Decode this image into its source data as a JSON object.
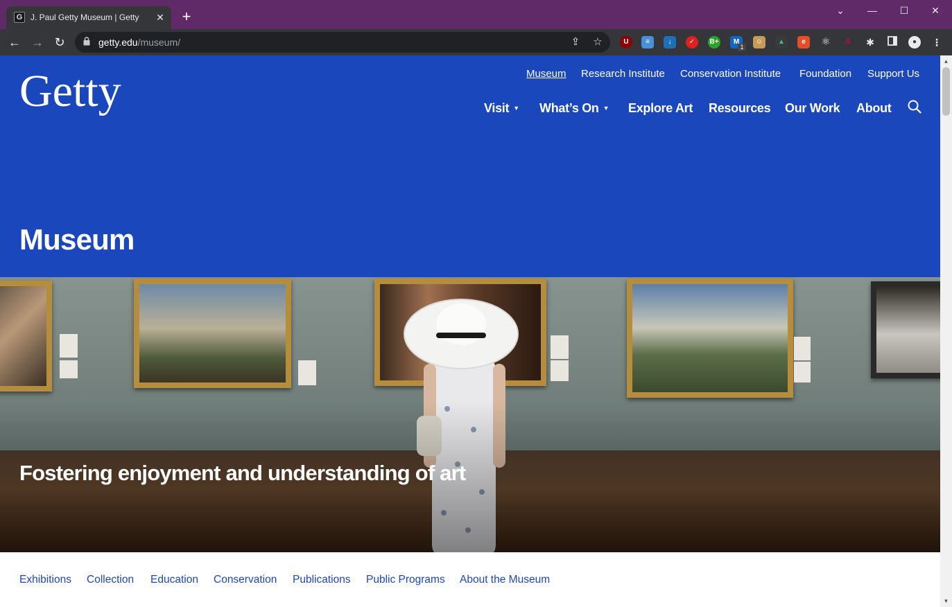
{
  "browser": {
    "tab_title": "J. Paul Getty Museum | Getty",
    "url_host": "getty.edu",
    "url_path": "/museum/",
    "tab_favicon_glyph": "G",
    "ext_labels": {
      "ublock": "U",
      "bplus": "B+",
      "angular": "A",
      "mcafee_badge": "1"
    }
  },
  "site": {
    "logo": "Getty",
    "utility_nav": [
      {
        "label": "Museum",
        "active": true
      },
      {
        "label": "Research Institute"
      },
      {
        "label": "Conservation Institute"
      },
      {
        "label": "Foundation"
      },
      {
        "label": "Support Us"
      }
    ],
    "main_nav": [
      {
        "label": "Visit",
        "dropdown": true
      },
      {
        "label": "What’s On",
        "dropdown": true
      },
      {
        "label": "Explore Art"
      },
      {
        "label": "Resources"
      },
      {
        "label": "Our Work"
      },
      {
        "label": "About"
      }
    ],
    "dropdown_glyph": "▼",
    "page_title": "Museum",
    "hero_caption": "Fostering enjoyment and understanding of art",
    "sub_nav": [
      "Exhibitions",
      "Collection",
      "Education",
      "Conservation",
      "Publications",
      "Public Programs",
      "About the Museum"
    ]
  },
  "colors": {
    "brand_blue": "#1b47bc",
    "titlebar": "#5f2a67",
    "toolbar": "#35363a"
  },
  "icons": [
    "back-icon",
    "forward-icon",
    "reload-icon",
    "lock-icon",
    "share-icon",
    "star-icon",
    "extensions-icon",
    "side-panel-icon",
    "profile-icon",
    "menu-icon",
    "search-icon",
    "close-icon",
    "minimize-icon",
    "maximize-icon",
    "tab-list-icon"
  ]
}
